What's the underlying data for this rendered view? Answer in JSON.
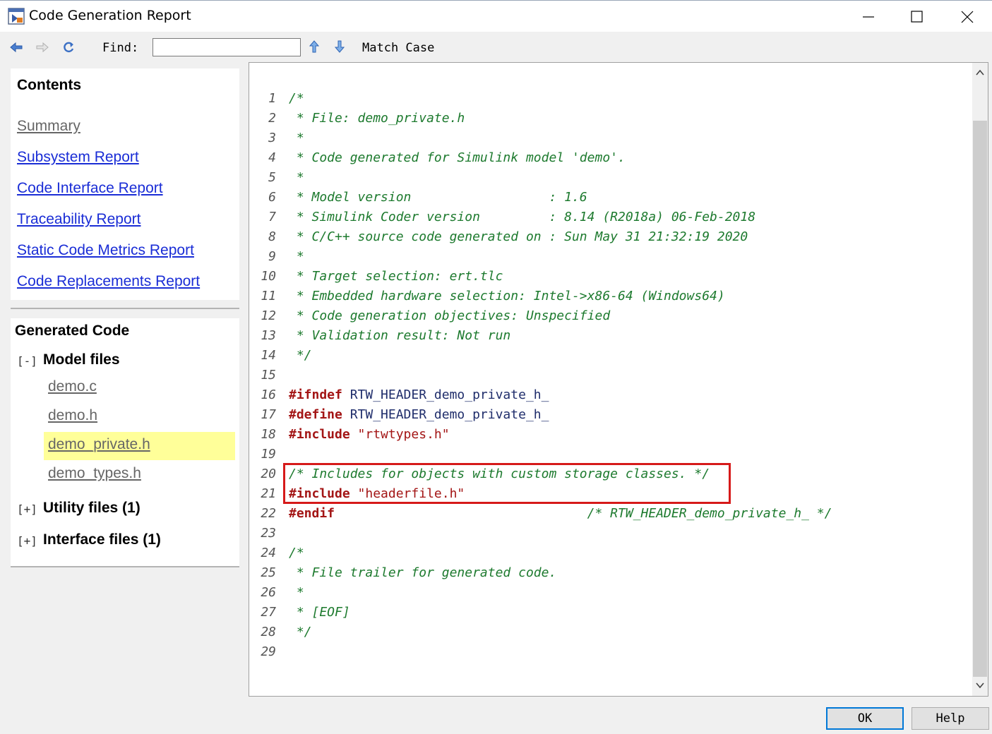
{
  "window": {
    "title": "Code Generation Report"
  },
  "toolbar": {
    "find_label": "Find:",
    "find_value": "",
    "match_case_label": "Match Case"
  },
  "contents": {
    "heading": "Contents",
    "links": [
      {
        "label": "Summary",
        "visited": true
      },
      {
        "label": "Subsystem Report",
        "visited": false
      },
      {
        "label": "Code Interface Report",
        "visited": false
      },
      {
        "label": "Traceability Report",
        "visited": false
      },
      {
        "label": "Static Code Metrics Report",
        "visited": false
      },
      {
        "label": "Code Replacements Report",
        "visited": false
      }
    ]
  },
  "generated_code": {
    "heading": "Generated Code",
    "model_files": {
      "toggle": "[-]",
      "label": "Model files",
      "files": [
        "demo.c",
        "demo.h",
        "demo_private.h",
        "demo_types.h"
      ],
      "selected": "demo_private.h"
    },
    "utility_files": {
      "toggle": "[+]",
      "label": "Utility files (1)"
    },
    "interface_files": {
      "toggle": "[+]",
      "label": "Interface files (1)"
    }
  },
  "code": {
    "lines": [
      {
        "n": "1",
        "segments": [
          {
            "t": "/*",
            "c": "cm"
          }
        ]
      },
      {
        "n": "2",
        "segments": [
          {
            "t": " * File: demo_private.h",
            "c": "cm"
          }
        ]
      },
      {
        "n": "3",
        "segments": [
          {
            "t": " *",
            "c": "cm"
          }
        ]
      },
      {
        "n": "4",
        "segments": [
          {
            "t": " * Code generated for Simulink model 'demo'.",
            "c": "cm"
          }
        ]
      },
      {
        "n": "5",
        "segments": [
          {
            "t": " *",
            "c": "cm"
          }
        ]
      },
      {
        "n": "6",
        "segments": [
          {
            "t": " * Model version                  : 1.6",
            "c": "cm"
          }
        ]
      },
      {
        "n": "7",
        "segments": [
          {
            "t": " * Simulink Coder version         : 8.14 (R2018a) 06-Feb-2018",
            "c": "cm"
          }
        ]
      },
      {
        "n": "8",
        "segments": [
          {
            "t": " * C/C++ source code generated on : Sun May 31 21:32:19 2020",
            "c": "cm"
          }
        ]
      },
      {
        "n": "9",
        "segments": [
          {
            "t": " *",
            "c": "cm"
          }
        ]
      },
      {
        "n": "10",
        "segments": [
          {
            "t": " * Target selection: ert.tlc",
            "c": "cm"
          }
        ]
      },
      {
        "n": "11",
        "segments": [
          {
            "t": " * Embedded hardware selection: Intel->x86-64 (Windows64)",
            "c": "cm"
          }
        ]
      },
      {
        "n": "12",
        "segments": [
          {
            "t": " * Code generation objectives: Unspecified",
            "c": "cm"
          }
        ]
      },
      {
        "n": "13",
        "segments": [
          {
            "t": " * Validation result: Not run",
            "c": "cm"
          }
        ]
      },
      {
        "n": "14",
        "segments": [
          {
            "t": " */",
            "c": "cm"
          }
        ]
      },
      {
        "n": "15",
        "segments": []
      },
      {
        "n": "16",
        "segments": [
          {
            "t": "#ifndef",
            "c": "kw"
          },
          {
            "t": " RTW_HEADER_demo_private_h_",
            "c": "id"
          }
        ]
      },
      {
        "n": "17",
        "segments": [
          {
            "t": "#define",
            "c": "kw"
          },
          {
            "t": " RTW_HEADER_demo_private_h_",
            "c": "id"
          }
        ]
      },
      {
        "n": "18",
        "segments": [
          {
            "t": "#include",
            "c": "kw"
          },
          {
            "t": " \"rtwtypes.h\"",
            "c": "st"
          }
        ]
      },
      {
        "n": "19",
        "segments": []
      },
      {
        "n": "20",
        "segments": [
          {
            "t": "/* Includes for objects with custom storage classes. */",
            "c": "cm"
          }
        ]
      },
      {
        "n": "21",
        "segments": [
          {
            "t": "#include",
            "c": "kw"
          },
          {
            "t": " \"headerfile.h\"",
            "c": "st"
          }
        ]
      },
      {
        "n": "22",
        "segments": [
          {
            "t": "#endif",
            "c": "kw"
          },
          {
            "t": "                                 ",
            "c": "id"
          },
          {
            "t": "/* RTW_HEADER_demo_private_h_ */",
            "c": "cm"
          }
        ]
      },
      {
        "n": "23",
        "segments": []
      },
      {
        "n": "24",
        "segments": [
          {
            "t": "/*",
            "c": "cm"
          }
        ]
      },
      {
        "n": "25",
        "segments": [
          {
            "t": " * File trailer for generated code.",
            "c": "cm"
          }
        ]
      },
      {
        "n": "26",
        "segments": [
          {
            "t": " *",
            "c": "cm"
          }
        ]
      },
      {
        "n": "27",
        "segments": [
          {
            "t": " * [EOF]",
            "c": "cm"
          }
        ]
      },
      {
        "n": "28",
        "segments": [
          {
            "t": " */",
            "c": "cm"
          }
        ]
      },
      {
        "n": "29",
        "segments": []
      }
    ]
  },
  "buttons": {
    "ok": "OK",
    "help": "Help"
  }
}
